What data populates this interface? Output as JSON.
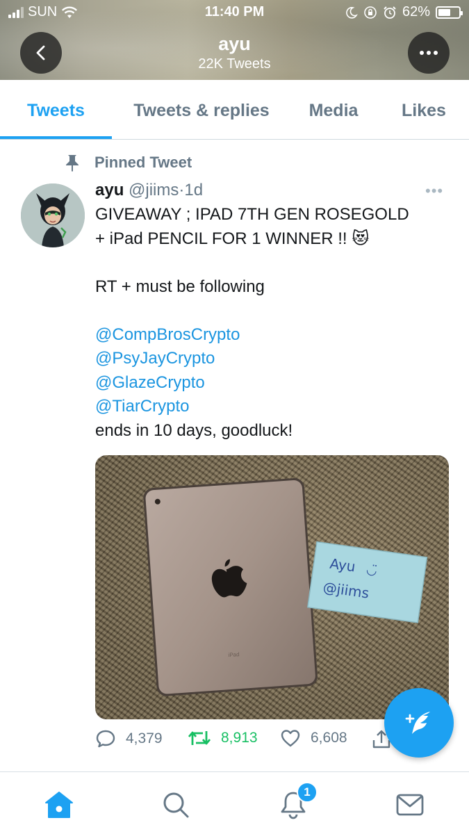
{
  "status_bar": {
    "carrier": "SUN",
    "time": "11:40 PM",
    "battery_percent": "62%",
    "battery_level": 0.62,
    "icons": [
      "signal-icon",
      "wifi-icon",
      "moon-icon",
      "orientation-lock-icon",
      "alarm-icon",
      "battery-icon"
    ]
  },
  "header": {
    "name": "ayu",
    "tweet_count": "22K Tweets",
    "back_icon": "chevron-left-icon",
    "more_icon": "ellipsis-icon"
  },
  "tabs": [
    {
      "label": "Tweets",
      "active": true
    },
    {
      "label": "Tweets & replies",
      "active": false
    },
    {
      "label": "Media",
      "active": false
    },
    {
      "label": "Likes",
      "active": false
    }
  ],
  "tweet": {
    "pinned_label": "Pinned Tweet",
    "display_name": "ayu",
    "handle": "@jiims",
    "separator": "·",
    "age": "1d",
    "menu_glyph": "•••",
    "body": {
      "line1": "GIVEAWAY ; IPAD 7TH GEN ROSEGOLD",
      "line2": "+ iPad PENCIL FOR 1 WINNER !!",
      "emoji": "😻",
      "line3": "RT + must be following",
      "mentions": [
        "@CompBrosCrypto",
        "@PsyJayCrypto",
        "@GlazeCrypto",
        "@TiarCrypto"
      ],
      "closing": "ends in 10 days, goodluck!"
    },
    "photo": {
      "note_line1": "Ayu",
      "note_smiley": "◡̈",
      "note_line2": "@jiims",
      "ipad_label": "iPad"
    },
    "stats": {
      "replies": "4,379",
      "retweets": "8,913",
      "likes": "6,608"
    }
  },
  "bottom_nav": {
    "items": [
      "home-icon",
      "search-icon",
      "notifications-icon",
      "messages-icon"
    ],
    "notification_count": "1"
  },
  "colors": {
    "accent": "#1da1f2",
    "mention": "#1b95e0",
    "retweet": "#17bf63",
    "muted": "#657786"
  }
}
